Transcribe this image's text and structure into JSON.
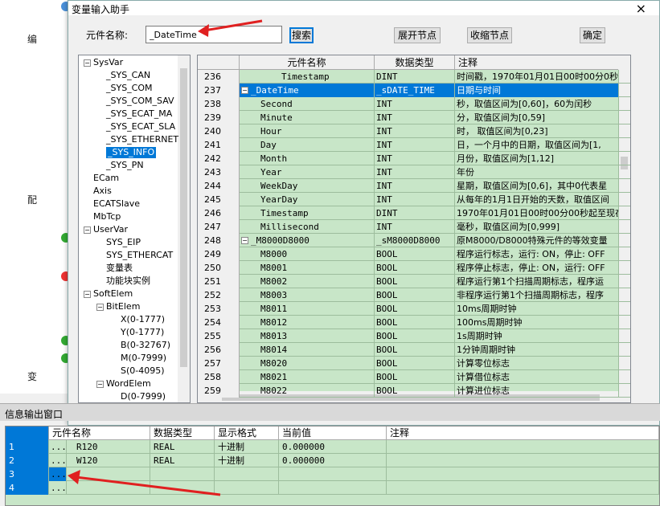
{
  "dialog": {
    "title": "变量输入助手",
    "close": "×"
  },
  "toolbar": {
    "name_label": "元件名称:",
    "name_value": "_DateTime",
    "search": "搜索",
    "expand": "展开节点",
    "collapse": "收缩节点",
    "ok": "确定"
  },
  "bg": {
    "rows": [
      "编",
      "配",
      "变"
    ]
  },
  "tree": {
    "items": [
      {
        "label": "SysVar",
        "level": 0,
        "pm": "−"
      },
      {
        "label": "_SYS_CAN",
        "level": 1
      },
      {
        "label": "_SYS_COM",
        "level": 1
      },
      {
        "label": "_SYS_COM_SAV",
        "level": 1
      },
      {
        "label": "_SYS_ECAT_MA",
        "level": 1
      },
      {
        "label": "_SYS_ECAT_SLA",
        "level": 1
      },
      {
        "label": "_SYS_ETHERNET",
        "level": 1
      },
      {
        "label": "_SYS_INFO",
        "level": 1,
        "selected": true
      },
      {
        "label": "_SYS_PN",
        "level": 1
      },
      {
        "label": "ECam",
        "level": 0
      },
      {
        "label": "Axis",
        "level": 0
      },
      {
        "label": "ECATSlave",
        "level": 0
      },
      {
        "label": "MbTcp",
        "level": 0
      },
      {
        "label": "UserVar",
        "level": 0,
        "pm": "−"
      },
      {
        "label": "SYS_EIP",
        "level": 1
      },
      {
        "label": "SYS_ETHERCAT",
        "level": 1
      },
      {
        "label": "变量表",
        "level": 1
      },
      {
        "label": "功能块实例",
        "level": 1
      },
      {
        "label": "SoftElem",
        "level": 0,
        "pm": "−"
      },
      {
        "label": "BitElem",
        "level": 1,
        "pm": "−"
      },
      {
        "label": "X(0-1777)",
        "level": 2
      },
      {
        "label": "Y(0-1777)",
        "level": 2
      },
      {
        "label": "B(0-32767)",
        "level": 2
      },
      {
        "label": "M(0-7999)",
        "level": 2
      },
      {
        "label": "S(0-4095)",
        "level": 2
      },
      {
        "label": "WordElem",
        "level": 1,
        "pm": "−"
      },
      {
        "label": "D(0-7999)",
        "level": 2
      }
    ]
  },
  "grid": {
    "headers": [
      "元件名称",
      "数据类型",
      "注释"
    ],
    "rows": [
      {
        "n": "236",
        "name": "Timestamp",
        "type": "DINT",
        "note": "时间戳，1970年01月01日00时00分0秒",
        "indent": 2
      },
      {
        "n": "237",
        "name": "_DateTime",
        "type": "_sDATE_TIME",
        "note": "日期与时间",
        "indent": 0,
        "pm": "−",
        "selected": true
      },
      {
        "n": "238",
        "name": "Second",
        "type": "INT",
        "note": "秒，取值区间为[0,60]，60为闰秒",
        "indent": 1
      },
      {
        "n": "239",
        "name": "Minute",
        "type": "INT",
        "note": "分，取值区间为[0,59]",
        "indent": 1
      },
      {
        "n": "240",
        "name": "Hour",
        "type": "INT",
        "note": "时， 取值区间为[0,23]",
        "indent": 1
      },
      {
        "n": "241",
        "name": "Day",
        "type": "INT",
        "note": "日，一个月中的日期，取值区间为[1,",
        "indent": 1
      },
      {
        "n": "242",
        "name": "Month",
        "type": "INT",
        "note": "月份，取值区间为[1,12]",
        "indent": 1
      },
      {
        "n": "243",
        "name": "Year",
        "type": "INT",
        "note": "年份",
        "indent": 1
      },
      {
        "n": "244",
        "name": "WeekDay",
        "type": "INT",
        "note": "星期，取值区间为[0,6]，其中0代表星",
        "indent": 1
      },
      {
        "n": "245",
        "name": "YearDay",
        "type": "INT",
        "note": "从每年的1月1日开始的天数，取值区间",
        "indent": 1
      },
      {
        "n": "246",
        "name": "Timestamp",
        "type": "DINT",
        "note": "1970年01月01日00时00分00秒起至现在",
        "indent": 1
      },
      {
        "n": "247",
        "name": "Millisecond",
        "type": "INT",
        "note": "毫秒，取值区间为[0,999]",
        "indent": 1
      },
      {
        "n": "248",
        "name": "_M8000D8000",
        "type": "_sM8000D8000",
        "note": "原M8000/D8000特殊元件的等效变量",
        "indent": 0,
        "pm": "−"
      },
      {
        "n": "249",
        "name": "M8000",
        "type": "BOOL",
        "note": "程序运行标志，运行: ON，停止: OFF",
        "indent": 1
      },
      {
        "n": "250",
        "name": "M8001",
        "type": "BOOL",
        "note": "程序停止标志，停止: ON，运行: OFF",
        "indent": 1
      },
      {
        "n": "251",
        "name": "M8002",
        "type": "BOOL",
        "note": "程序运行第1个扫描周期标志，程序运",
        "indent": 1
      },
      {
        "n": "252",
        "name": "M8003",
        "type": "BOOL",
        "note": "非程序运行第1个扫描周期标志，程序",
        "indent": 1
      },
      {
        "n": "253",
        "name": "M8011",
        "type": "BOOL",
        "note": "10ms周期时钟",
        "indent": 1
      },
      {
        "n": "254",
        "name": "M8012",
        "type": "BOOL",
        "note": "100ms周期时钟",
        "indent": 1
      },
      {
        "n": "255",
        "name": "M8013",
        "type": "BOOL",
        "note": "1s周期时钟",
        "indent": 1
      },
      {
        "n": "256",
        "name": "M8014",
        "type": "BOOL",
        "note": "1分钟周期时钟",
        "indent": 1
      },
      {
        "n": "257",
        "name": "M8020",
        "type": "BOOL",
        "note": "计算零位标志",
        "indent": 1
      },
      {
        "n": "258",
        "name": "M8021",
        "type": "BOOL",
        "note": "计算借位标志",
        "indent": 1
      },
      {
        "n": "259",
        "name": "M8022",
        "type": "BOOL",
        "note": "计算进位标志",
        "indent": 1
      }
    ]
  },
  "output": {
    "title": "信息输出窗口",
    "headers": [
      "元件名称",
      "数据类型",
      "显示格式",
      "当前值",
      "注释"
    ],
    "rows": [
      {
        "n": "1",
        "dots": "...",
        "name": "R120",
        "type": "REAL",
        "fmt": "十进制",
        "val": "0.000000"
      },
      {
        "n": "2",
        "dots": "...",
        "name": "W120",
        "type": "REAL",
        "fmt": "十进制",
        "val": "0.000000"
      },
      {
        "n": "3",
        "dots": "...",
        "name": "",
        "type": "",
        "fmt": "",
        "val": ""
      },
      {
        "n": "4",
        "dots": "...",
        "name": "",
        "type": "",
        "fmt": "",
        "val": ""
      }
    ]
  },
  "colors": {
    "accent": "#0078d7",
    "grid_bg": "#c8e6c8",
    "arrow": "#e02020"
  }
}
